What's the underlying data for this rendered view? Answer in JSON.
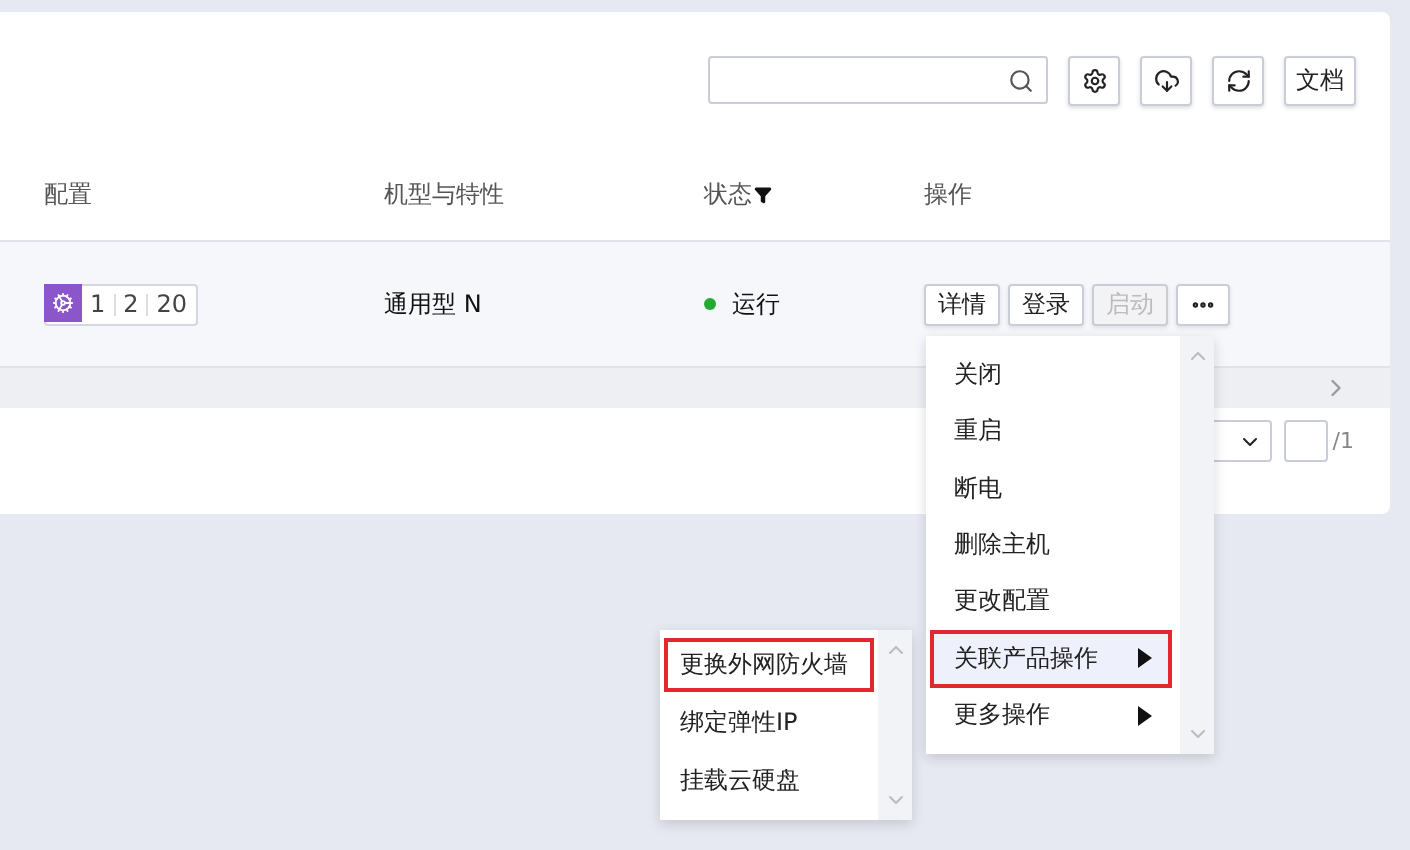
{
  "toolbar": {
    "buttons": [
      {
        "kind": "settings"
      },
      {
        "kind": "cloud"
      },
      {
        "kind": "refresh"
      },
      {
        "kind": "text",
        "label": "文档"
      }
    ]
  },
  "table": {
    "columns": [
      {
        "label": "配置",
        "kind": "plain"
      },
      {
        "label": "机型与特性",
        "kind": "plain"
      },
      {
        "label": "状态",
        "kind": "filter"
      },
      {
        "label": "操作",
        "kind": "plain"
      }
    ],
    "rows": [
      {
        "config": [
          "1",
          "2",
          "20"
        ],
        "type": "通用型 N",
        "status": {
          "text": "运行",
          "color": "#22aa33"
        },
        "actions": [
          {
            "kind": "text",
            "label": "详情",
            "disabled": false
          },
          {
            "kind": "text",
            "label": "登录",
            "disabled": false
          },
          {
            "kind": "text",
            "label": "启动",
            "disabled": true
          },
          {
            "kind": "more"
          }
        ]
      }
    ]
  },
  "pagination": {
    "total": "/1"
  },
  "menu": {
    "items": [
      {
        "label": "关闭",
        "selected": false,
        "submenu": false
      },
      {
        "label": "重启",
        "selected": false,
        "submenu": false
      },
      {
        "label": "断电",
        "selected": false,
        "submenu": false
      },
      {
        "label": "删除主机",
        "selected": false,
        "submenu": false
      },
      {
        "label": "更改配置",
        "selected": false,
        "submenu": false
      },
      {
        "label": "关联产品操作",
        "selected": true,
        "submenu": true
      },
      {
        "label": "更多操作",
        "selected": false,
        "submenu": true
      }
    ]
  },
  "submenu": {
    "items": [
      {
        "label": "更换外网防火墙",
        "selected": true
      },
      {
        "label": "绑定弹性IP",
        "selected": false
      },
      {
        "label": "挂载云硬盘",
        "selected": false
      }
    ]
  }
}
